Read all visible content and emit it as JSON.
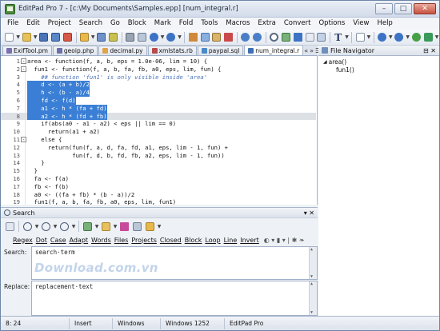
{
  "window": {
    "title": "EditPad Pro 7 - [c:\\My Documents\\Samples.epp] [num_integral.r]",
    "buttons": {
      "minimize": "–",
      "maximize": "□",
      "close": "✕"
    }
  },
  "menu": [
    "File",
    "Edit",
    "Project",
    "Search",
    "Go",
    "Block",
    "Mark",
    "Fold",
    "Tools",
    "Macros",
    "Extra",
    "Convert",
    "Options",
    "View",
    "Help"
  ],
  "tabs": [
    {
      "label": "ExifTool.pm",
      "color": "#7a6fb0",
      "active": false
    },
    {
      "label": "geoip.php",
      "color": "#6d6fa8",
      "active": false
    },
    {
      "label": "decimal.py",
      "color": "#e0a34a",
      "active": false
    },
    {
      "label": "xmlstats.rb",
      "color": "#b84b4b",
      "active": false
    },
    {
      "label": "paypal.sql",
      "color": "#4a8ac8",
      "active": false
    },
    {
      "label": "num_integral.r",
      "color": "#3d6fb4",
      "active": true
    }
  ],
  "tab_nav": {
    "prev": "«",
    "next": "»",
    "list": "☰",
    "close": "✕"
  },
  "editor": {
    "lines": [
      {
        "num": "1",
        "fold": "-",
        "text": "area <- function(f, a, b, eps = 1.0e-06, lim = 10) {"
      },
      {
        "num": "2",
        "fold": "-",
        "text": "  fun1 <- function(f, a, b, fa, fb, a0, eps, lim, fun) {"
      },
      {
        "num": "3",
        "fold": "",
        "text": "    ## function 'fun1' is only visible inside 'area'"
      },
      {
        "num": "4",
        "fold": "",
        "text": "    d <- (a + b)/2"
      },
      {
        "num": "5",
        "fold": "",
        "text": "    h <- (b - a)/4"
      },
      {
        "num": "6",
        "fold": "",
        "text": "    fd <- f(d)"
      },
      {
        "num": "7",
        "fold": "",
        "text": "    a1 <- h * (fa + fd)"
      },
      {
        "num": "8",
        "fold": "",
        "text": "    a2 <- h * (fd + fb)"
      },
      {
        "num": "9",
        "fold": "",
        "text": "    if(abs(a0 - a1 - a2) < eps || lim == 0)"
      },
      {
        "num": "10",
        "fold": "",
        "text": "      return(a1 + a2)"
      },
      {
        "num": "11",
        "fold": "-",
        "text": "    else {"
      },
      {
        "num": "12",
        "fold": "",
        "text": "      return(fun(f, a, d, fa, fd, a1, eps, lim - 1, fun) +"
      },
      {
        "num": "13",
        "fold": "",
        "text": "             fun(f, d, b, fd, fb, a2, eps, lim - 1, fun))"
      },
      {
        "num": "14",
        "fold": "",
        "text": "    }"
      },
      {
        "num": "15",
        "fold": "",
        "text": "  }"
      },
      {
        "num": "16",
        "fold": "",
        "text": "  fa <- f(a)"
      },
      {
        "num": "17",
        "fold": "",
        "text": "  fb <- f(b)"
      },
      {
        "num": "18",
        "fold": "",
        "text": "  a0 <- ((fa + fb) * (b - a))/2"
      },
      {
        "num": "19",
        "fold": "",
        "text": "  fun1(f, a, b, fa, fb, a0, eps, lim, fun1)"
      },
      {
        "num": "20",
        "fold": "",
        "text": "}"
      }
    ]
  },
  "file_navigator": {
    "title": "File Navigator",
    "nodes": [
      {
        "label": "area()",
        "children": [
          "fun1()"
        ]
      }
    ]
  },
  "search": {
    "title": "Search",
    "options": [
      "Regex",
      "Dot",
      "Case",
      "Adapt",
      "Words",
      "Files",
      "Projects",
      "Closed",
      "Block",
      "Loop",
      "Line",
      "Invert"
    ],
    "search_label": "Search:",
    "search_value": "search·term",
    "replace_label": "Replace:",
    "replace_value": "replacement·text",
    "watermark": "Download.com.vn"
  },
  "status": {
    "position": "8: 24",
    "mode": "Insert",
    "linebreaks": "Windows",
    "encoding": "Windows 1252",
    "edition": "EditPad Pro"
  }
}
